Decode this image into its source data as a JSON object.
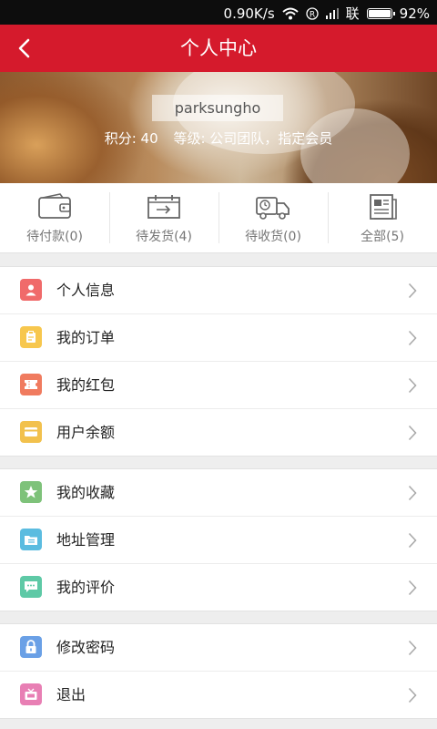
{
  "status_bar": {
    "speed": "0.90K/s",
    "carrier": "联",
    "battery": "92%",
    "battery_level": 0.92
  },
  "header": {
    "title": "个人中心"
  },
  "profile": {
    "username": "parksungho",
    "points": "积分: 40",
    "level": "等级: 公司团队，指定会员"
  },
  "orders": [
    {
      "label": "待付款(0)",
      "icon": "wallet-icon"
    },
    {
      "label": "待发货(4)",
      "icon": "package-ship-icon"
    },
    {
      "label": "待收货(0)",
      "icon": "delivery-truck-icon"
    },
    {
      "label": "全部(5)",
      "icon": "order-list-icon"
    }
  ],
  "menu_groups": [
    [
      {
        "label": "个人信息",
        "icon": "user-info-icon",
        "color": "#f06a6a"
      },
      {
        "label": "我的订单",
        "icon": "clipboard-icon",
        "color": "#f7c74e"
      },
      {
        "label": "我的红包",
        "icon": "coupon-icon",
        "color": "#f07b5f"
      },
      {
        "label": "用户余额",
        "icon": "card-icon",
        "color": "#f2c14d"
      }
    ],
    [
      {
        "label": "我的收藏",
        "icon": "star-icon",
        "color": "#7ec27a"
      },
      {
        "label": "地址管理",
        "icon": "address-folder-icon",
        "color": "#5bbce0"
      },
      {
        "label": "我的评价",
        "icon": "comment-icon",
        "color": "#5ec9a6"
      }
    ],
    [
      {
        "label": "修改密码",
        "icon": "lock-icon",
        "color": "#6aa0e6"
      },
      {
        "label": "退出",
        "icon": "logout-tv-icon",
        "color": "#e87fb4"
      }
    ]
  ]
}
